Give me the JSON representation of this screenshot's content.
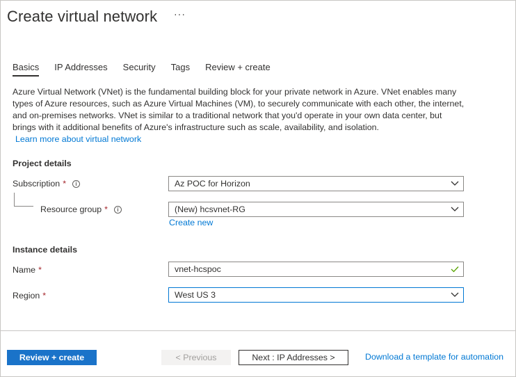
{
  "header": {
    "title": "Create virtual network",
    "more": "···"
  },
  "tabs": [
    {
      "label": "Basics",
      "active": true
    },
    {
      "label": "IP Addresses",
      "active": false
    },
    {
      "label": "Security",
      "active": false
    },
    {
      "label": "Tags",
      "active": false
    },
    {
      "label": "Review + create",
      "active": false
    }
  ],
  "description": {
    "text": "Azure Virtual Network (VNet) is the fundamental building block for your private network in Azure. VNet enables many types of Azure resources, such as Azure Virtual Machines (VM), to securely communicate with each other, the internet, and on-premises networks. VNet is similar to a traditional network that you'd operate in your own data center, but brings with it additional benefits of Azure's infrastructure such as scale, availability, and isolation.",
    "learn_more": "Learn more about virtual network"
  },
  "project": {
    "heading": "Project details",
    "subscription_label": "Subscription",
    "subscription_value": "Az POC for Horizon",
    "resource_group_label": "Resource group",
    "resource_group_value": "(New) hcsvnet-RG",
    "create_new": "Create new",
    "required_mark": "*",
    "info_glyph": "i"
  },
  "instance": {
    "heading": "Instance details",
    "name_label": "Name",
    "name_value": "vnet-hcspoc",
    "region_label": "Region",
    "region_value": "West US 3"
  },
  "footer": {
    "review_create": "Review + create",
    "previous": "< Previous",
    "next": "Next : IP Addresses >",
    "download": "Download a template for automation"
  },
  "colors": {
    "accent": "#0078d4",
    "primary_button": "#1a73c9",
    "required": "#a4262c",
    "valid": "#57a300"
  }
}
